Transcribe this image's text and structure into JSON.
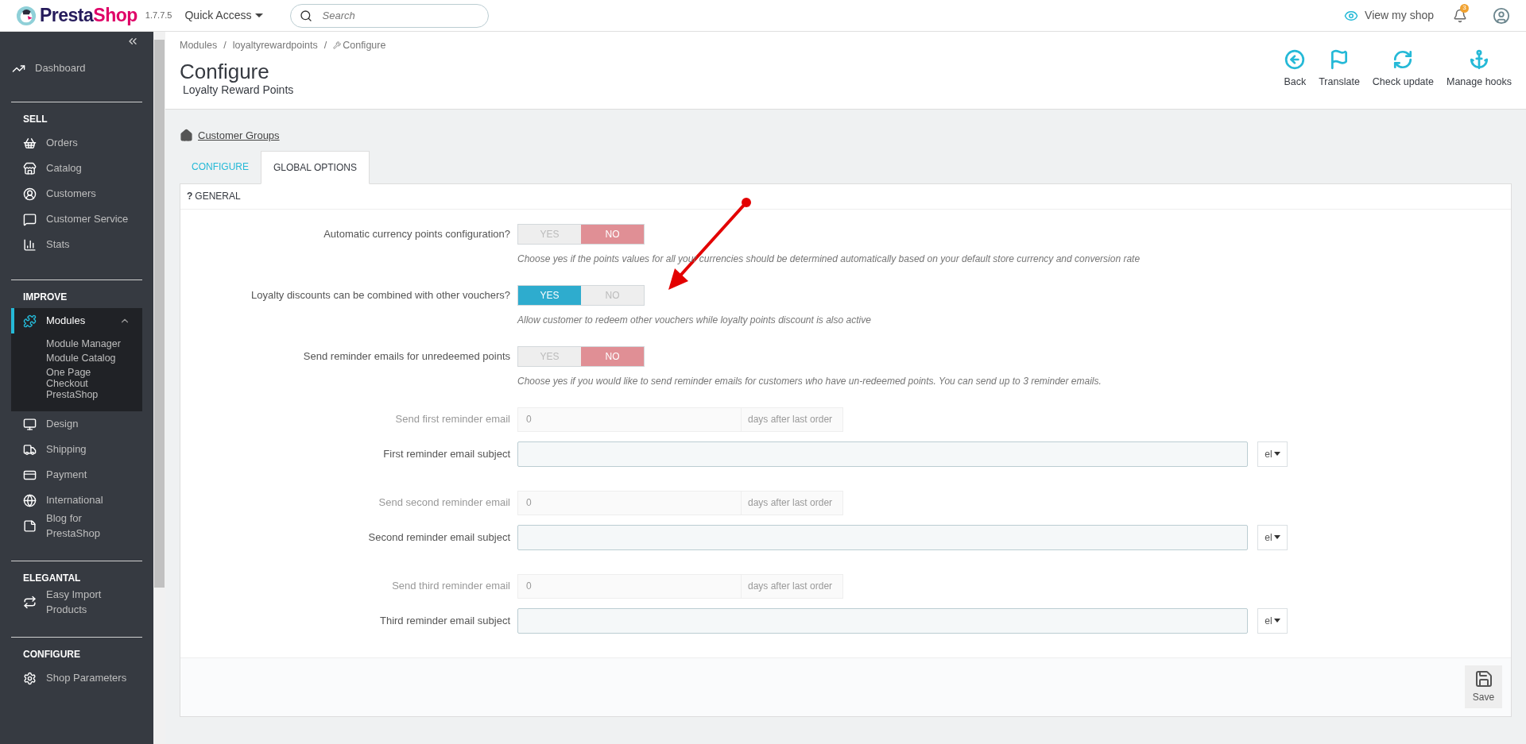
{
  "header": {
    "logo_parts": [
      "Presta",
      "Shop"
    ],
    "version": "1.7.7.5",
    "quick_access": "Quick Access",
    "search": {
      "placeholder": "Search"
    },
    "view_shop": "View my shop",
    "notifications": "3"
  },
  "sidebar": {
    "sections": [
      {
        "items": [
          {
            "label": "Dashboard",
            "selected": false
          }
        ]
      },
      {
        "title": "SELL",
        "items": [
          {
            "label": "Orders",
            "selected": false
          },
          {
            "label": "Catalog",
            "selected": false
          },
          {
            "label": "Customers",
            "selected": false
          },
          {
            "label": "Customer Service",
            "selected": false
          },
          {
            "label": "Stats",
            "selected": false
          }
        ]
      },
      {
        "title": "IMPROVE",
        "items": [
          {
            "label": "Modules",
            "selected": true,
            "expanded": true,
            "children": [
              {
                "label": "Module Manager"
              },
              {
                "label": "Module Catalog"
              },
              {
                "label": "One Page Checkout PrestaShop"
              }
            ]
          },
          {
            "label": "Design",
            "selected": false
          },
          {
            "label": "Shipping",
            "selected": false
          },
          {
            "label": "Payment",
            "selected": false
          },
          {
            "label": "International",
            "selected": false
          },
          {
            "label": "Blog for PrestaShop",
            "selected": false
          }
        ]
      },
      {
        "title": "ELEGANTAL",
        "items": [
          {
            "label": "Easy Import Products",
            "selected": false
          }
        ]
      },
      {
        "title": "CONFIGURE",
        "items": [
          {
            "label": "Shop Parameters",
            "selected": false
          }
        ]
      }
    ]
  },
  "page_head": {
    "breadcrumb": [
      {
        "kind": "link",
        "label": "Modules"
      },
      {
        "kind": "separator",
        "label": "/"
      },
      {
        "kind": "link",
        "label": "loyaltyrewardpoints"
      },
      {
        "kind": "separator",
        "label": "/"
      },
      {
        "kind": "current",
        "label": "Configure"
      }
    ],
    "title": "Configure",
    "subtitle": "Loyalty Reward Points",
    "toolbar": [
      "Back",
      "Translate",
      "Check update",
      "Manage hooks"
    ]
  },
  "home_link": "Customer Groups",
  "tabs": [
    {
      "label": "CONFIGURE",
      "selected": false
    },
    {
      "label": "GLOBAL OPTIONS",
      "selected": true
    }
  ],
  "panel": {
    "heading_mark": "?",
    "heading": "GENERAL",
    "fields": [
      {
        "kind": "toggle",
        "label": "Automatic currency points configuration?",
        "yes": "YES",
        "no": "NO",
        "on": false,
        "help": "Choose yes if the points values for all your currencies should be determined automatically based on your default store currency and conversion rate"
      },
      {
        "kind": "toggle",
        "label": "Loyalty discounts can be combined with other vouchers?",
        "yes": "YES",
        "no": "NO",
        "on": true,
        "help": "Allow customer to redeem other vouchers while loyalty points discount is also active"
      },
      {
        "kind": "toggle",
        "label": "Send reminder emails for unredeemed points",
        "yes": "YES",
        "no": "NO",
        "on": false,
        "help": "Choose yes if you would like to send reminder emails for customers who have un-redeemed points. You can send up to 3 reminder emails."
      },
      {
        "kind": "days",
        "label": "Send first reminder email",
        "value": "0",
        "suffix": "days after last order",
        "disabled": true
      },
      {
        "kind": "text",
        "label": "First reminder email subject",
        "lang": "el"
      },
      {
        "kind": "days",
        "label": "Send second reminder email",
        "value": "0",
        "suffix": "days after last order",
        "disabled": true
      },
      {
        "kind": "text",
        "label": "Second reminder email subject",
        "lang": "el"
      },
      {
        "kind": "days",
        "label": "Send third reminder email",
        "value": "0",
        "suffix": "days after last order",
        "disabled": true
      },
      {
        "kind": "text",
        "label": "Third reminder email subject",
        "lang": "el"
      }
    ],
    "save": "Save"
  }
}
